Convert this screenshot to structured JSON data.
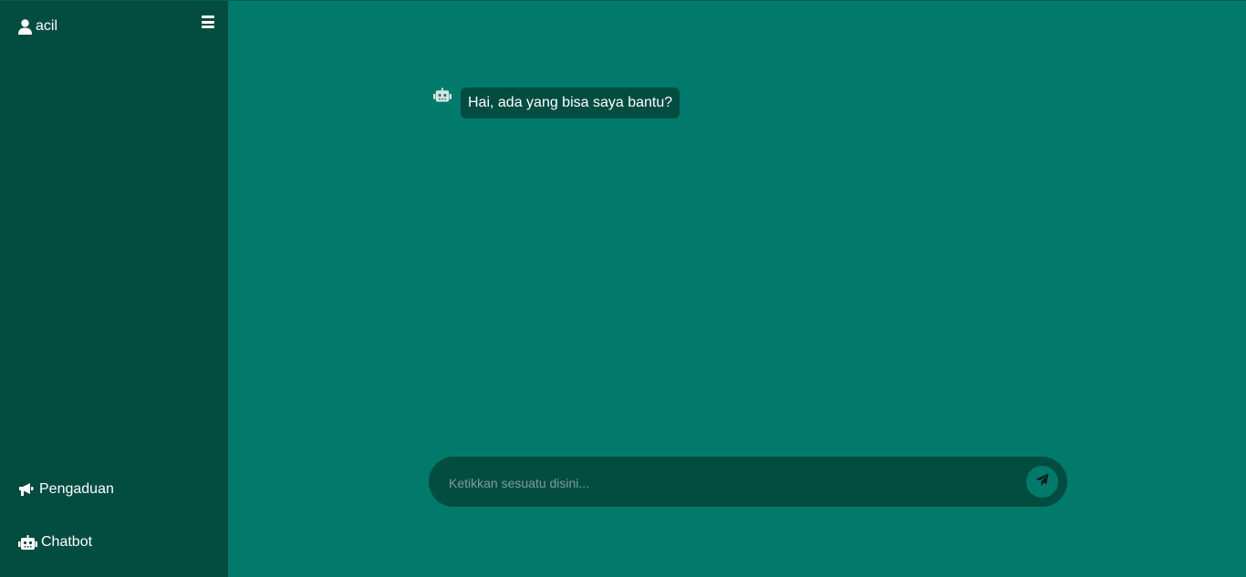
{
  "sidebar": {
    "user": {
      "name": "acil",
      "icon": "user-icon"
    },
    "toggle": {
      "icon": "hamburger-menu-icon"
    },
    "items": [
      {
        "label": "Pengaduan",
        "icon": "megaphone-icon"
      },
      {
        "label": "Chatbot",
        "icon": "robot-icon"
      }
    ]
  },
  "chat": {
    "messages": [
      {
        "sender": "bot",
        "icon": "robot-icon",
        "text": "Hai, ada yang bisa saya bantu?"
      }
    ],
    "input": {
      "placeholder": "Ketikkan sesuatu disini...",
      "value": ""
    },
    "send": {
      "icon": "paper-plane-icon"
    }
  },
  "colors": {
    "main_bg": "#017a6c",
    "sidebar_bg": "#034c40",
    "bubble_bg": "#034c40",
    "text": "#ffffff"
  }
}
